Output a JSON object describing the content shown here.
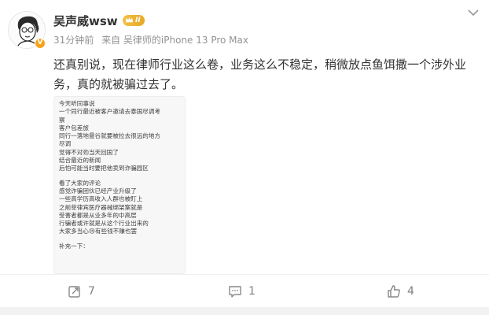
{
  "post": {
    "author": "吴声威wsw",
    "level_badge": "II",
    "verified_badge": "V",
    "time": "31分钟前",
    "source": "来自 吴律师的iPhone 13 Pro Max",
    "text": "还真别说，现在律师行业这么卷，业务这么不稳定，稍微放点鱼饵撒一个涉外业务，真的就被骗过去了。",
    "image_lines": [
      "今天听同事说",
      "一个同行最近被客户邀请去泰国尽调考",
      "察",
      "客户包差旅",
      "同行一落地曼谷就要被拉去很远的地方",
      "尽调",
      "觉得不对劲当天回国了",
      "结合最近的新闻",
      "后怕可能当时要把他卖到诈骗园区",
      "",
      "看了大家的评论",
      "感觉诈骗团伙已经产业升级了",
      "一些高学历高收入人群也被盯上",
      "之前菲律宾医疗器械绑架案就是",
      "受害者都是从业多年的中高层",
      "行骗者或许就是从这个行业出来的",
      "大家多当心😢有些钱不赚也罢",
      "",
      "补充一下："
    ]
  },
  "actions": {
    "repost_count": "7",
    "comment_count": "1",
    "like_count": "4"
  },
  "icons": [
    "more-icon",
    "repost-icon",
    "comment-icon",
    "like-icon",
    "crown-icon"
  ]
}
